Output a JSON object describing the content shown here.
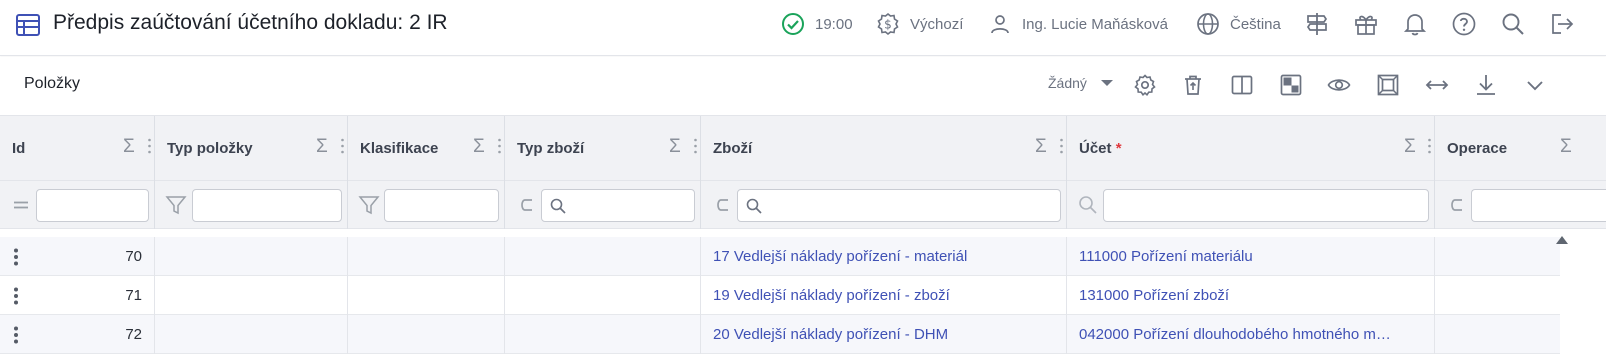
{
  "header": {
    "title": "Předpis zaúčtování účetního dokladu: 2 IR",
    "time": "19:00",
    "currency": "Výchozí",
    "user": "Ing. Lucie Maňásková",
    "language": "Čeština",
    "icons": [
      "table-icon",
      "check-circle-icon",
      "dollar-badge-icon",
      "user-icon",
      "globe-icon",
      "signpost-icon",
      "gift-icon",
      "bell-icon",
      "help-icon",
      "search-icon",
      "logout-icon"
    ]
  },
  "section": {
    "title": "Položky",
    "view_value": "Žádný",
    "toolbar_icons": [
      "gear-icon",
      "delete-icon",
      "split-view-icon",
      "layout-icon",
      "eye-icon",
      "fit-screen-icon",
      "expand-horizontal-icon",
      "download-icon",
      "chevron-down-icon"
    ]
  },
  "grid": {
    "columns": [
      {
        "label": "Id",
        "required": false
      },
      {
        "label": "Typ položky",
        "required": false
      },
      {
        "label": "Klasifikace",
        "required": false
      },
      {
        "label": "Typ zboží",
        "required": false
      },
      {
        "label": "Zboží",
        "required": false
      },
      {
        "label": "Účet",
        "required": true,
        "required_mark": "*"
      },
      {
        "label": "Operace",
        "required": false
      }
    ],
    "rows": [
      {
        "id": "70",
        "typ_polozky": "",
        "klasifikace": "",
        "typ_zbozi": "",
        "zbozi": "17 Vedlejší náklady pořízení - materiál",
        "ucet": "111000 Pořízení materiálu",
        "operace": ""
      },
      {
        "id": "71",
        "typ_polozky": "",
        "klasifikace": "",
        "typ_zbozi": "",
        "zbozi": "19 Vedlejší náklady pořízení - zboží",
        "ucet": "131000 Pořízení zboží",
        "operace": ""
      },
      {
        "id": "72",
        "typ_polozky": "",
        "klasifikace": "",
        "typ_zbozi": "",
        "zbozi": "20 Vedlejší náklady pořízení - DHM",
        "ucet": "042000 Pořízení dlouhodobého hmotného m…",
        "operace": ""
      }
    ]
  },
  "colors": {
    "accent": "#3f51b5",
    "success": "#1aa35a",
    "required": "#e0393e"
  }
}
